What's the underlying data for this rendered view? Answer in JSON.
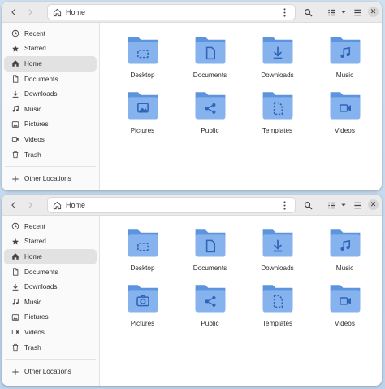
{
  "windows": [
    {
      "id": "top",
      "path_label": "Home",
      "sidebar": [
        {
          "label": "Recent",
          "icon": "clock-icon"
        },
        {
          "label": "Starred",
          "icon": "star-icon"
        },
        {
          "label": "Home",
          "icon": "home-icon",
          "active": true
        },
        {
          "label": "Documents",
          "icon": "document-icon"
        },
        {
          "label": "Downloads",
          "icon": "download-icon"
        },
        {
          "label": "Music",
          "icon": "music-icon"
        },
        {
          "label": "Pictures",
          "icon": "picture-icon"
        },
        {
          "label": "Videos",
          "icon": "video-icon"
        },
        {
          "label": "Trash",
          "icon": "trash-icon"
        }
      ],
      "other_locations": "Other Locations",
      "folders": [
        {
          "label": "Desktop",
          "emblem": "desktop"
        },
        {
          "label": "Documents",
          "emblem": "document"
        },
        {
          "label": "Downloads",
          "emblem": "download"
        },
        {
          "label": "Music",
          "emblem": "music"
        },
        {
          "label": "Pictures",
          "emblem": "picture"
        },
        {
          "label": "Public",
          "emblem": "share"
        },
        {
          "label": "Templates",
          "emblem": "template"
        },
        {
          "label": "Videos",
          "emblem": "video"
        }
      ]
    },
    {
      "id": "bottom",
      "path_label": "Home",
      "sidebar": [
        {
          "label": "Recent",
          "icon": "clock-icon"
        },
        {
          "label": "Starred",
          "icon": "star-icon"
        },
        {
          "label": "Home",
          "icon": "home-icon",
          "active": true
        },
        {
          "label": "Documents",
          "icon": "document-icon"
        },
        {
          "label": "Downloads",
          "icon": "download-icon"
        },
        {
          "label": "Music",
          "icon": "music-icon"
        },
        {
          "label": "Pictures",
          "icon": "picture-icon"
        },
        {
          "label": "Videos",
          "icon": "video-icon"
        },
        {
          "label": "Trash",
          "icon": "trash-icon"
        }
      ],
      "other_locations": "Other Locations",
      "folders": [
        {
          "label": "Desktop",
          "emblem": "desktop"
        },
        {
          "label": "Documents",
          "emblem": "document"
        },
        {
          "label": "Downloads",
          "emblem": "download"
        },
        {
          "label": "Music",
          "emblem": "music"
        },
        {
          "label": "Pictures",
          "emblem": "camera"
        },
        {
          "label": "Public",
          "emblem": "share"
        },
        {
          "label": "Templates",
          "emblem": "template"
        },
        {
          "label": "Videos",
          "emblem": "video"
        }
      ]
    }
  ],
  "colors": {
    "folder_back": "#5c94dd",
    "folder_front": "#86b3ee",
    "emblem": "#2f64b8",
    "desktop_bg": "#c6daef"
  }
}
